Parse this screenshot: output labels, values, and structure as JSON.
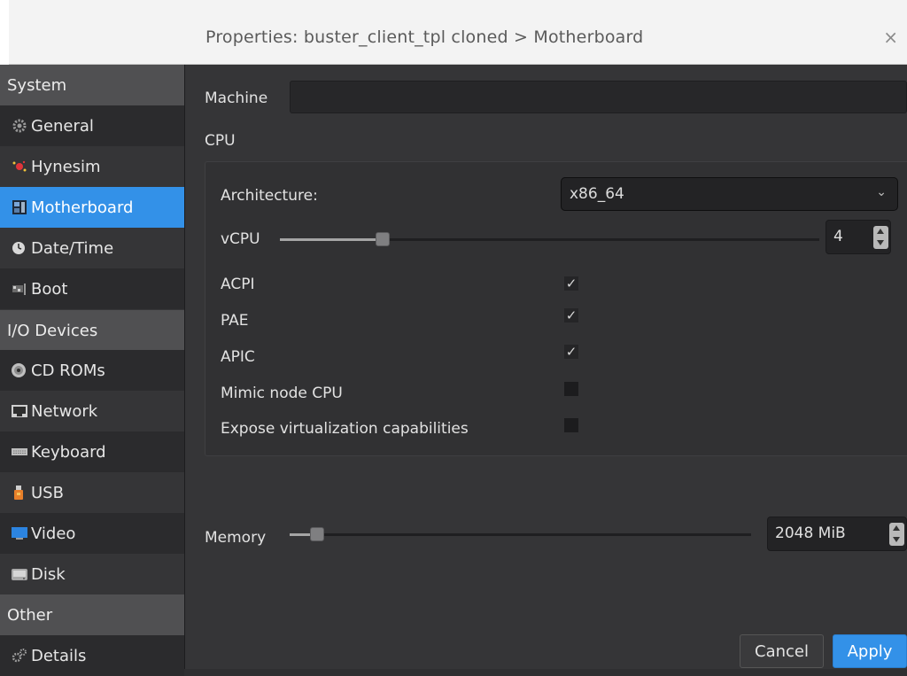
{
  "window": {
    "title": "Properties: buster_client_tpl cloned > Motherboard",
    "close_glyph": "×"
  },
  "sidebar": {
    "items": [
      {
        "label": "System",
        "kind": "header"
      },
      {
        "label": "General",
        "icon": "gear-icon"
      },
      {
        "label": "Hynesim",
        "icon": "hynesim-icon"
      },
      {
        "label": "Motherboard",
        "icon": "motherboard-icon",
        "selected": true
      },
      {
        "label": "Date/Time",
        "icon": "clock-icon"
      },
      {
        "label": "Boot",
        "icon": "boot-icon"
      },
      {
        "label": "I/O Devices",
        "kind": "header"
      },
      {
        "label": "CD ROMs",
        "icon": "cdrom-icon"
      },
      {
        "label": "Network",
        "icon": "network-icon"
      },
      {
        "label": "Keyboard",
        "icon": "keyboard-icon"
      },
      {
        "label": "USB",
        "icon": "usb-icon"
      },
      {
        "label": "Video",
        "icon": "video-icon"
      },
      {
        "label": "Disk",
        "icon": "disk-icon"
      },
      {
        "label": "Other",
        "kind": "header"
      },
      {
        "label": "Details",
        "icon": "details-icon"
      }
    ]
  },
  "main": {
    "machine_label": "Machine",
    "machine_value": "",
    "cpu_section_label": "CPU",
    "architecture_label": "Architecture:",
    "architecture_value": "x86_64",
    "vcpu_label": "vCPU",
    "vcpu_value": "4",
    "vcpu_level": 0.19,
    "options": [
      {
        "label": "ACPI",
        "checked": true
      },
      {
        "label": "PAE",
        "checked": true
      },
      {
        "label": "APIC",
        "checked": true
      },
      {
        "label": "Mimic node CPU",
        "checked": false
      },
      {
        "label": "Expose virtualization capabilities",
        "checked": false
      }
    ],
    "check_glyph": "✓",
    "memory_label": "Memory",
    "memory_value": "2048 MiB",
    "memory_level": 0.06
  },
  "buttons": {
    "cancel": "Cancel",
    "apply": "Apply"
  },
  "colors": {
    "accent": "#3391e8",
    "background": "#353537",
    "titlebar": "#f3f3f3"
  }
}
